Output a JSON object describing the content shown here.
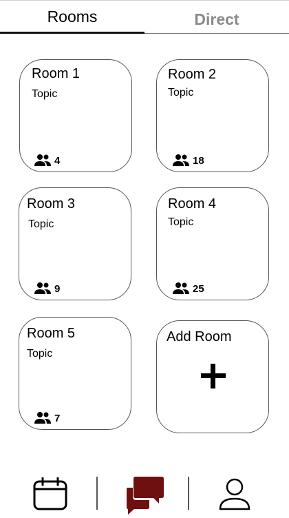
{
  "tabs": [
    {
      "label": "Rooms",
      "active": true
    },
    {
      "label": "Direct",
      "active": false
    }
  ],
  "rooms": [
    {
      "name": "Room 1",
      "topic": "Topic",
      "members": "4"
    },
    {
      "name": "Room 2",
      "topic": "Topic",
      "members": "18"
    },
    {
      "name": "Room 3",
      "topic": "Topic",
      "members": "9"
    },
    {
      "name": "Room 4",
      "topic": "Topic",
      "members": "25"
    },
    {
      "name": "Room 5",
      "topic": "Topic",
      "members": "7"
    }
  ],
  "add_room": {
    "label": "Add Room",
    "icon": "plus-icon"
  },
  "bottom_nav": {
    "items": [
      {
        "icon": "calendar-icon"
      },
      {
        "icon": "chat-icon",
        "active": true
      },
      {
        "icon": "profile-icon"
      }
    ]
  },
  "colors": {
    "active_nav": "#6e1010",
    "inactive_tab": "#8a8a8a",
    "card_border": "#555555"
  }
}
